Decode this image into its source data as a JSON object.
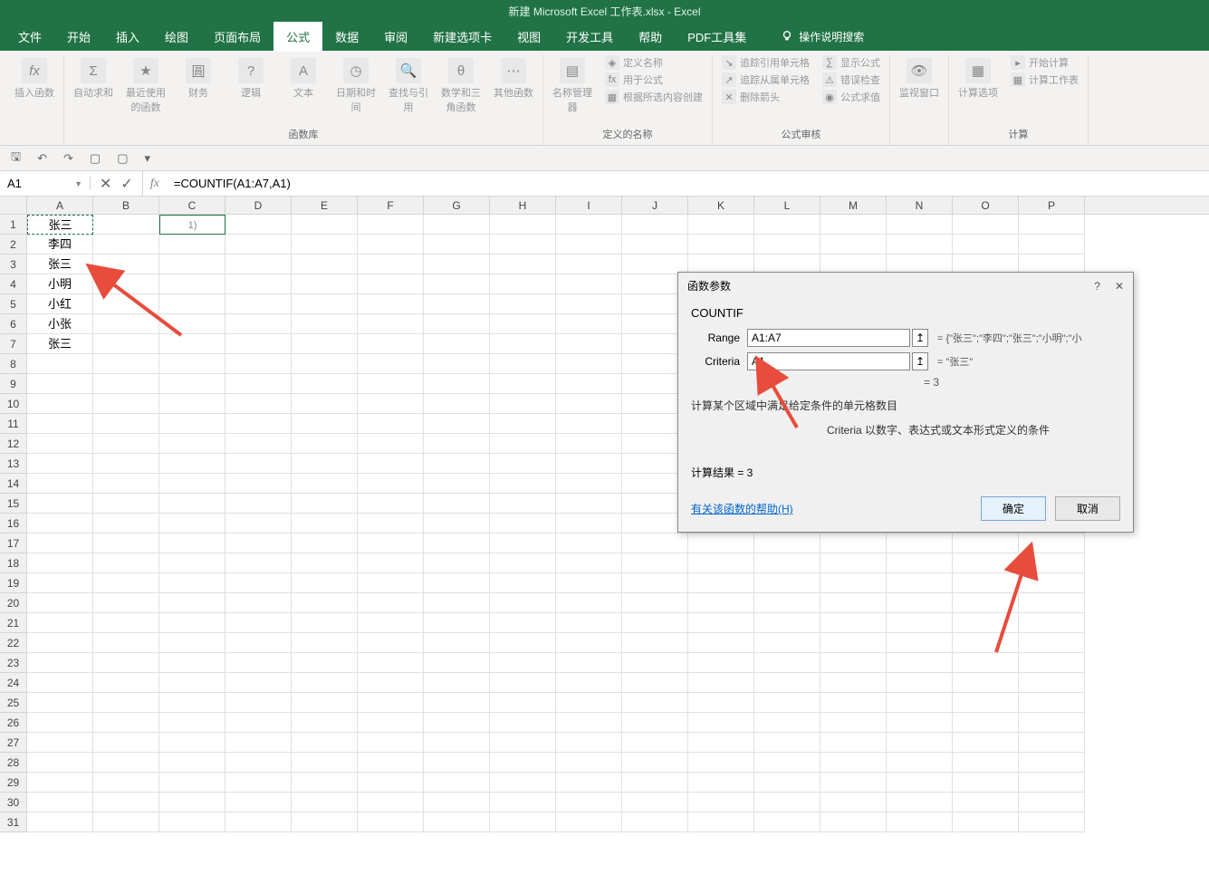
{
  "app": {
    "title": "新建 Microsoft Excel 工作表.xlsx - Excel"
  },
  "tabs": [
    "文件",
    "开始",
    "插入",
    "绘图",
    "页面布局",
    "公式",
    "数据",
    "审阅",
    "新建选项卡",
    "视图",
    "开发工具",
    "帮助",
    "PDF工具集"
  ],
  "tabs_active_index": 5,
  "search_hint": "操作说明搜索",
  "ribbon": {
    "groups": {
      "insert_fn": "插入函数",
      "fn_lib": "函数库",
      "names": "定义的名称",
      "audit": "公式审核",
      "calc": "计算"
    },
    "btns": {
      "fx": "插入函数",
      "autosum": "自动求和",
      "recent": "最近使用的函数",
      "financial": "财务",
      "logical": "逻辑",
      "text": "文本",
      "datetime": "日期和时间",
      "lookup": "查找与引用",
      "math": "数学和三角函数",
      "more": "其他函数",
      "name_mgr": "名称管理器",
      "define_name": "定义名称",
      "use_formula": "用于公式",
      "create_sel": "根据所选内容创建",
      "trace_prec": "追踪引用单元格",
      "trace_dep": "追踪从属单元格",
      "remove_arrows": "删除箭头",
      "show_formulas": "显示公式",
      "error_check": "错误检查",
      "eval_formula": "公式求值",
      "watch": "监视窗口",
      "calc_opts": "计算选项",
      "calc_now": "开始计算",
      "calc_sheet": "计算工作表"
    }
  },
  "name_box": "A1",
  "formula": "=COUNTIF(A1:A7,A1)",
  "columns": [
    "A",
    "B",
    "C",
    "D",
    "E",
    "F",
    "G",
    "H",
    "I",
    "J",
    "K",
    "L",
    "M",
    "N",
    "O",
    "P"
  ],
  "rows": 31,
  "cell_data": {
    "A": [
      "张三",
      "李四",
      "张三",
      "小明",
      "小红",
      "小张",
      "张三"
    ],
    "C1": "1)"
  },
  "dialog": {
    "title": "函数参数",
    "fn_name": "COUNTIF",
    "range_label": "Range",
    "range_value": "A1:A7",
    "range_eval": "= {\"张三\";\"李四\";\"张三\";\"小明\";\"小",
    "criteria_label": "Criteria",
    "criteria_value": "A1",
    "criteria_eval": "= \"张三\"",
    "result_eq": "= 3",
    "desc": "计算某个区域中满足给定条件的单元格数目",
    "crit_desc": "Criteria  以数字、表达式或文本形式定义的条件",
    "result_label": "计算结果 = 3",
    "help_link": "有关该函数的帮助(H)",
    "ok": "确定",
    "cancel": "取消"
  }
}
